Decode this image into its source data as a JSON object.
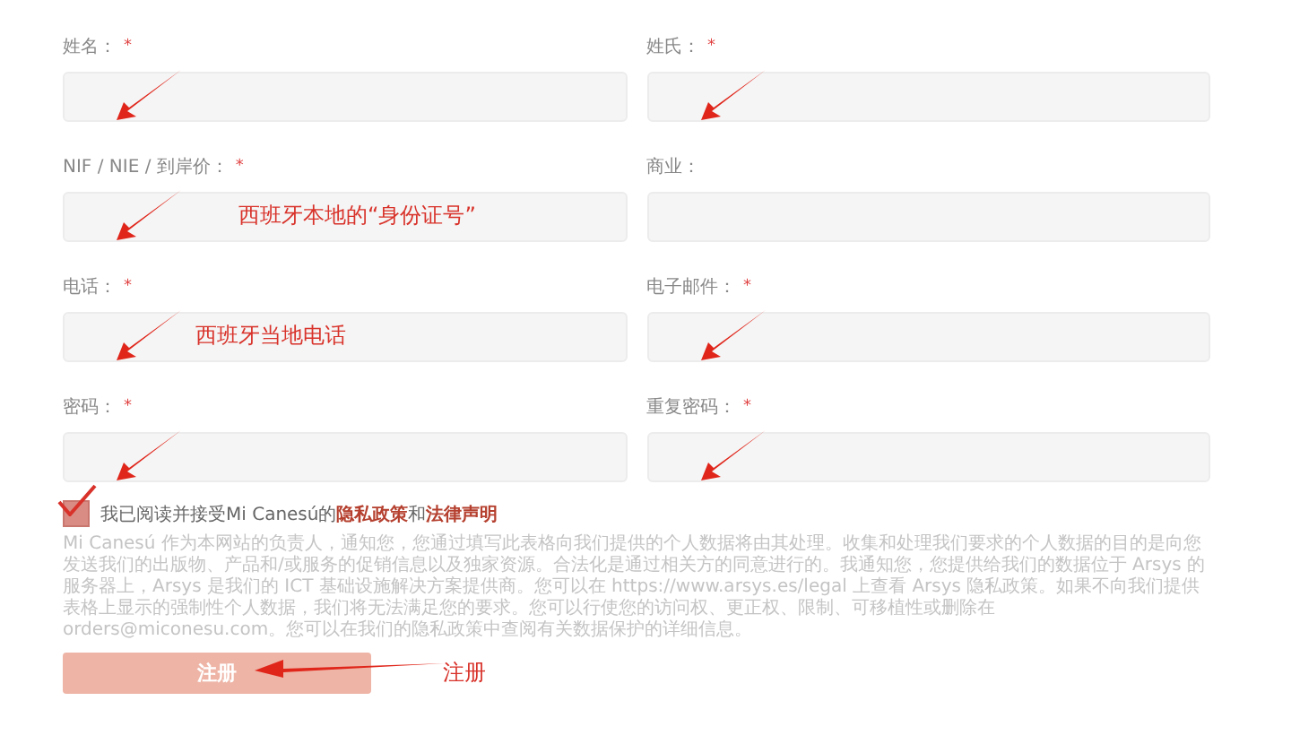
{
  "fields": [
    {
      "label": "姓名：",
      "required_mark": "*"
    },
    {
      "label": "姓氏：",
      "required_mark": "*"
    },
    {
      "label": "NIF / NIE / 到岸价：",
      "required_mark": "*",
      "annotation": "西班牙本地的“身份证号”"
    },
    {
      "label": "商业："
    },
    {
      "label": "电话：",
      "required_mark": "*",
      "annotation": "西班牙当地电话"
    },
    {
      "label": "电子邮件：",
      "required_mark": "*"
    },
    {
      "label": "密码：",
      "required_mark": "*"
    },
    {
      "label": "重复密码：",
      "required_mark": "*"
    }
  ],
  "consent": {
    "checked": true,
    "text": "我已阅读并接受Mi Canesú的**隐私政策**和**法律声明**"
  },
  "disclaimer": "Mi Canesú 作为本网站的负责人，通知您，您通过填写此表格向我们提供的个人数据将由其处理。收集和处理我们要求的个人数据的目的是向您发送我们的出版物、产品和/或服务的促销信息以及独家资源。合法化是通过相关方的同意进行的。我通知您，您提供给我们的数据位于 Arsys 的服务器上，Arsys 是我们的 ICT 基础设施解决方案提供商。您可以在 https://www.arsys.es/legal 上查看 Arsys 隐私政策。如果不向我们提供表格上显示的强制性个人数据，我们将无法满足您的要求。您可以行使您的访问权、更正权、限制、可移植性或删除在 orders@miconesu.com。您可以在我们的隐私政策中查阅有关数据保护的详细信息。",
  "submit": {
    "label": "注册",
    "annotation": "注册"
  }
}
